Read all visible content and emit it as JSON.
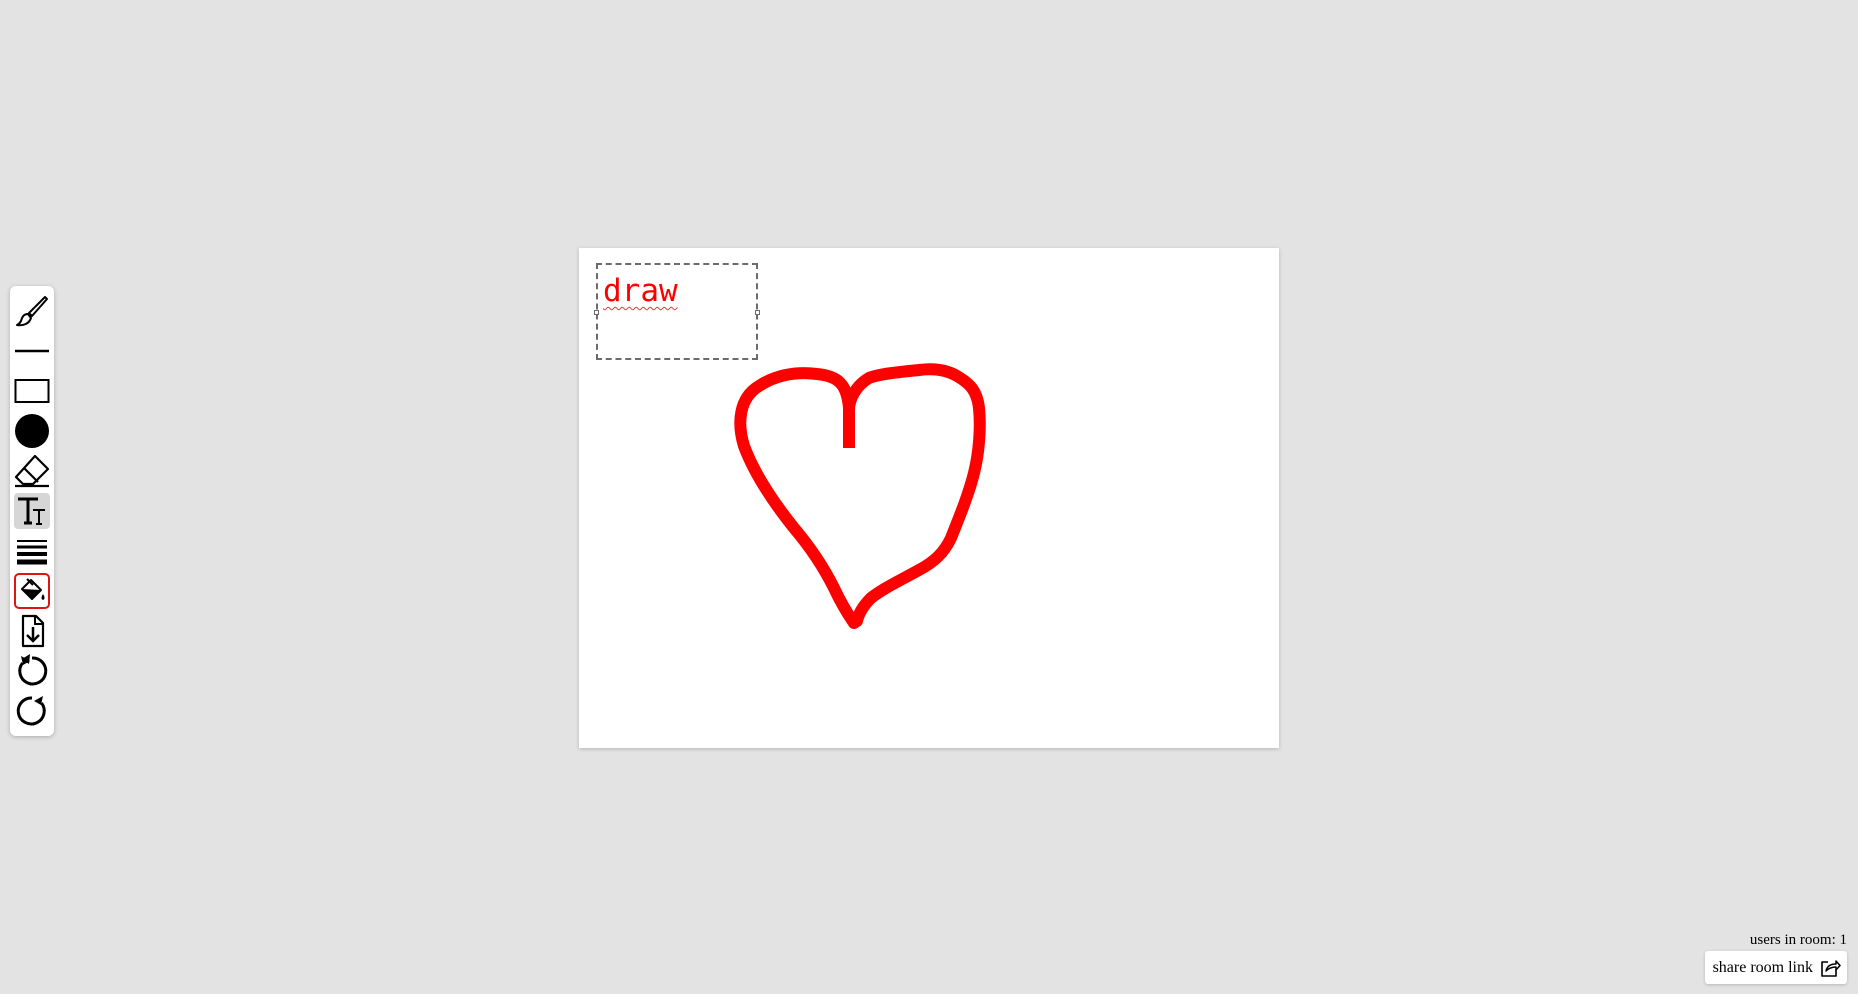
{
  "toolbar": {
    "tools": [
      {
        "name": "brush",
        "icon": "brush-icon"
      },
      {
        "name": "line",
        "icon": "line-icon"
      },
      {
        "name": "rectangle",
        "icon": "rectangle-icon"
      },
      {
        "name": "circle",
        "icon": "circle-icon"
      },
      {
        "name": "eraser",
        "icon": "eraser-icon"
      },
      {
        "name": "text",
        "icon": "text-icon",
        "active": true
      },
      {
        "name": "stroke-width",
        "icon": "stroke-width-icon"
      },
      {
        "name": "fill",
        "icon": "paint-bucket-icon",
        "selected_color": "#e11414"
      },
      {
        "name": "download",
        "icon": "download-file-icon"
      },
      {
        "name": "undo",
        "icon": "undo-icon"
      },
      {
        "name": "redo",
        "icon": "redo-icon"
      }
    ]
  },
  "canvas": {
    "text_box": {
      "content": "draw"
    },
    "drawing": {
      "shape": "heart",
      "stroke_color": "#ff0000"
    }
  },
  "footer": {
    "users_in_room": "users in room: 1",
    "share_label": "share room link",
    "share_icon": "share-icon"
  },
  "colors": {
    "background": "#e3e3e3",
    "canvas": "#ffffff",
    "accent": "#ff0000"
  }
}
